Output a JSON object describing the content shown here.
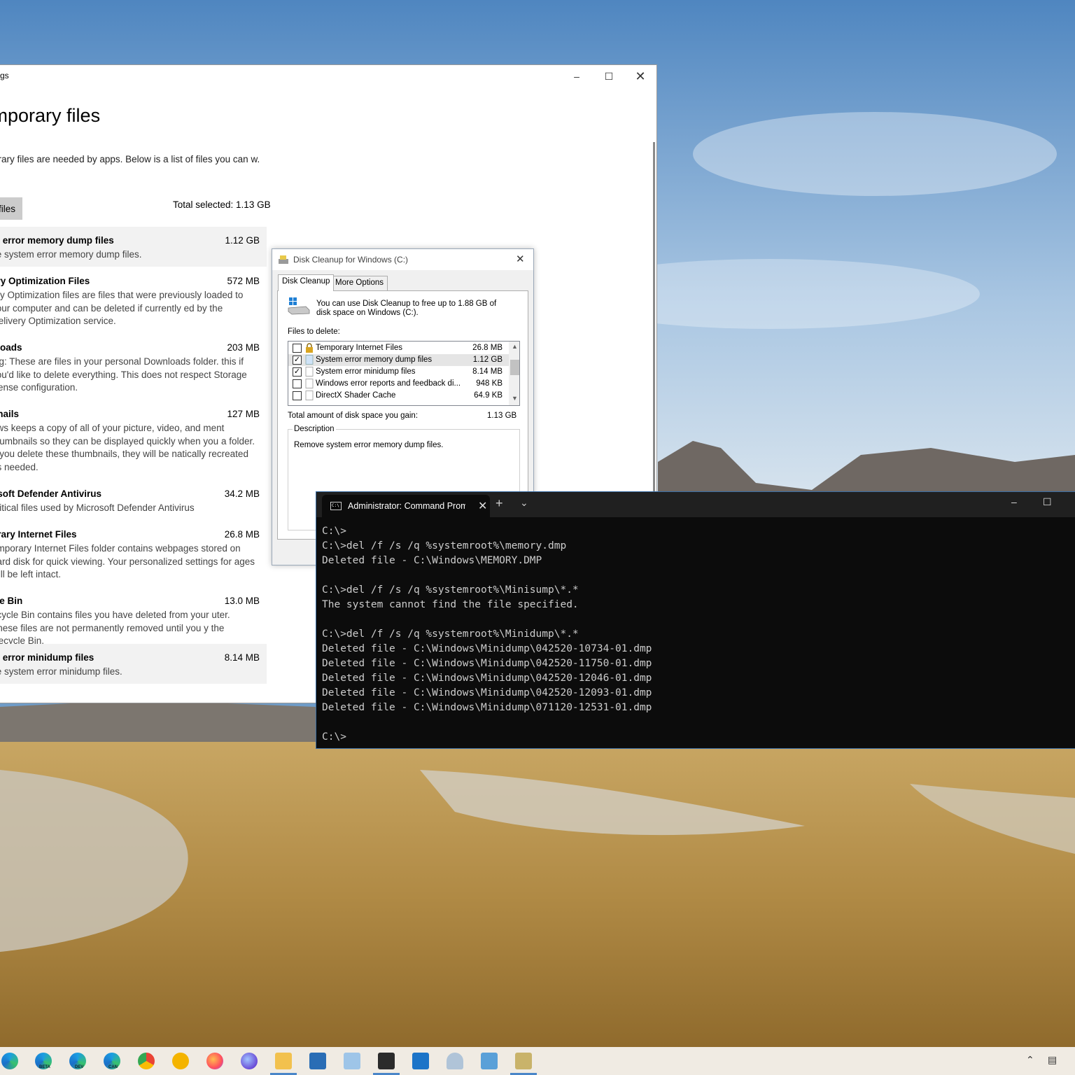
{
  "settings": {
    "window_title": "gs",
    "page_title": "mporary files",
    "intro": "orary files are needed by apps. Below is a list of files you can w.",
    "remove_button": "files",
    "total_selected": "Total selected: 1.13 GB",
    "items": [
      {
        "name": "m error memory dump files",
        "size": "1.12 GB",
        "desc": "ve system error memory dump files.",
        "selected": true
      },
      {
        "name": "ery Optimization Files",
        "size": "572 MB",
        "desc": "ery Optimization files are files that were previously loaded to your computer and can be deleted if currently ed by the Delivery Optimization service.",
        "selected": false
      },
      {
        "name": "nloads",
        "size": "203 MB",
        "desc": "ing: These are files in your personal Downloads folder. this if you'd like to delete everything. This does not respect Storage Sense configuration.",
        "selected": false
      },
      {
        "name": "bnails",
        "size": "127 MB",
        "desc": "ows keeps a copy of all of your picture, video, and ment thumbnails so they can be displayed quickly when you a folder. If you delete these thumbnails, they will be natically recreated as needed.",
        "selected": false
      },
      {
        "name": "osoft Defender Antivirus",
        "size": "34.2 MB",
        "desc": "critical files used by Microsoft Defender Antivirus",
        "selected": false
      },
      {
        "name": "orary Internet Files",
        "size": "26.8 MB",
        "desc": "emporary Internet Files folder contains webpages stored on hard disk for quick viewing. Your personalized settings for ages will be left intact.",
        "selected": false
      },
      {
        "name": "cle Bin",
        "size": "13.0 MB",
        "desc": "ecycle Bin contains files you have deleted from your uter. These files are not permanently removed until you y the Recycle Bin.",
        "selected": false
      },
      {
        "name": "m error minidump files",
        "size": "8.14 MB",
        "desc": "ve system error minidump files.",
        "selected": true
      }
    ]
  },
  "disk_cleanup": {
    "title": "Disk Cleanup for Windows (C:)",
    "tabs": [
      "Disk Cleanup",
      "More Options"
    ],
    "info": "You can use Disk Cleanup to free up to 1.88 GB of disk space on Windows (C:).",
    "files_to_delete_label": "Files to delete:",
    "files": [
      {
        "name": "Temporary Internet Files",
        "size": "26.8 MB",
        "checked": false
      },
      {
        "name": "System error memory dump files",
        "size": "1.12 GB",
        "checked": true
      },
      {
        "name": "System error minidump files",
        "size": "8.14 MB",
        "checked": true
      },
      {
        "name": "Windows error reports and feedback di...",
        "size": "948 KB",
        "checked": false
      },
      {
        "name": "DirectX Shader Cache",
        "size": "64.9 KB",
        "checked": false
      }
    ],
    "total_label": "Total amount of disk space you gain:",
    "total_value": "1.13 GB",
    "description_label": "Description",
    "description_text": "Remove system error memory dump files."
  },
  "terminal": {
    "tab_title": "Administrator: Command Prompt",
    "lines": [
      "C:\\>",
      "C:\\>del /f /s /q %systemroot%\\memory.dmp",
      "Deleted file - C:\\Windows\\MEMORY.DMP",
      "",
      "C:\\>del /f /s /q %systemroot%\\Minisump\\*.*",
      "The system cannot find the file specified.",
      "",
      "C:\\>del /f /s /q %systemroot%\\Minidump\\*.*",
      "Deleted file - C:\\Windows\\Minidump\\042520-10734-01.dmp",
      "Deleted file - C:\\Windows\\Minidump\\042520-11750-01.dmp",
      "Deleted file - C:\\Windows\\Minidump\\042520-12046-01.dmp",
      "Deleted file - C:\\Windows\\Minidump\\042520-12093-01.dmp",
      "Deleted file - C:\\Windows\\Minidump\\071120-12531-01.dmp",
      "",
      "C:\\>"
    ]
  },
  "taskbar": {
    "icons": [
      "edge-icon",
      "edge-beta-icon",
      "edge-dev-icon",
      "edge-canary-icon",
      "chrome-icon",
      "chrome-canary-icon",
      "firefox-icon",
      "firefox-nightly-icon",
      "file-explorer-icon",
      "powershell-icon",
      "notepad-icon",
      "terminal-icon",
      "photos-icon",
      "disk-icon",
      "control-panel-icon",
      "disk-cleanup-icon"
    ],
    "badges": {
      "beta": "BETA",
      "dev": "DEV",
      "canary": "CAN"
    }
  }
}
